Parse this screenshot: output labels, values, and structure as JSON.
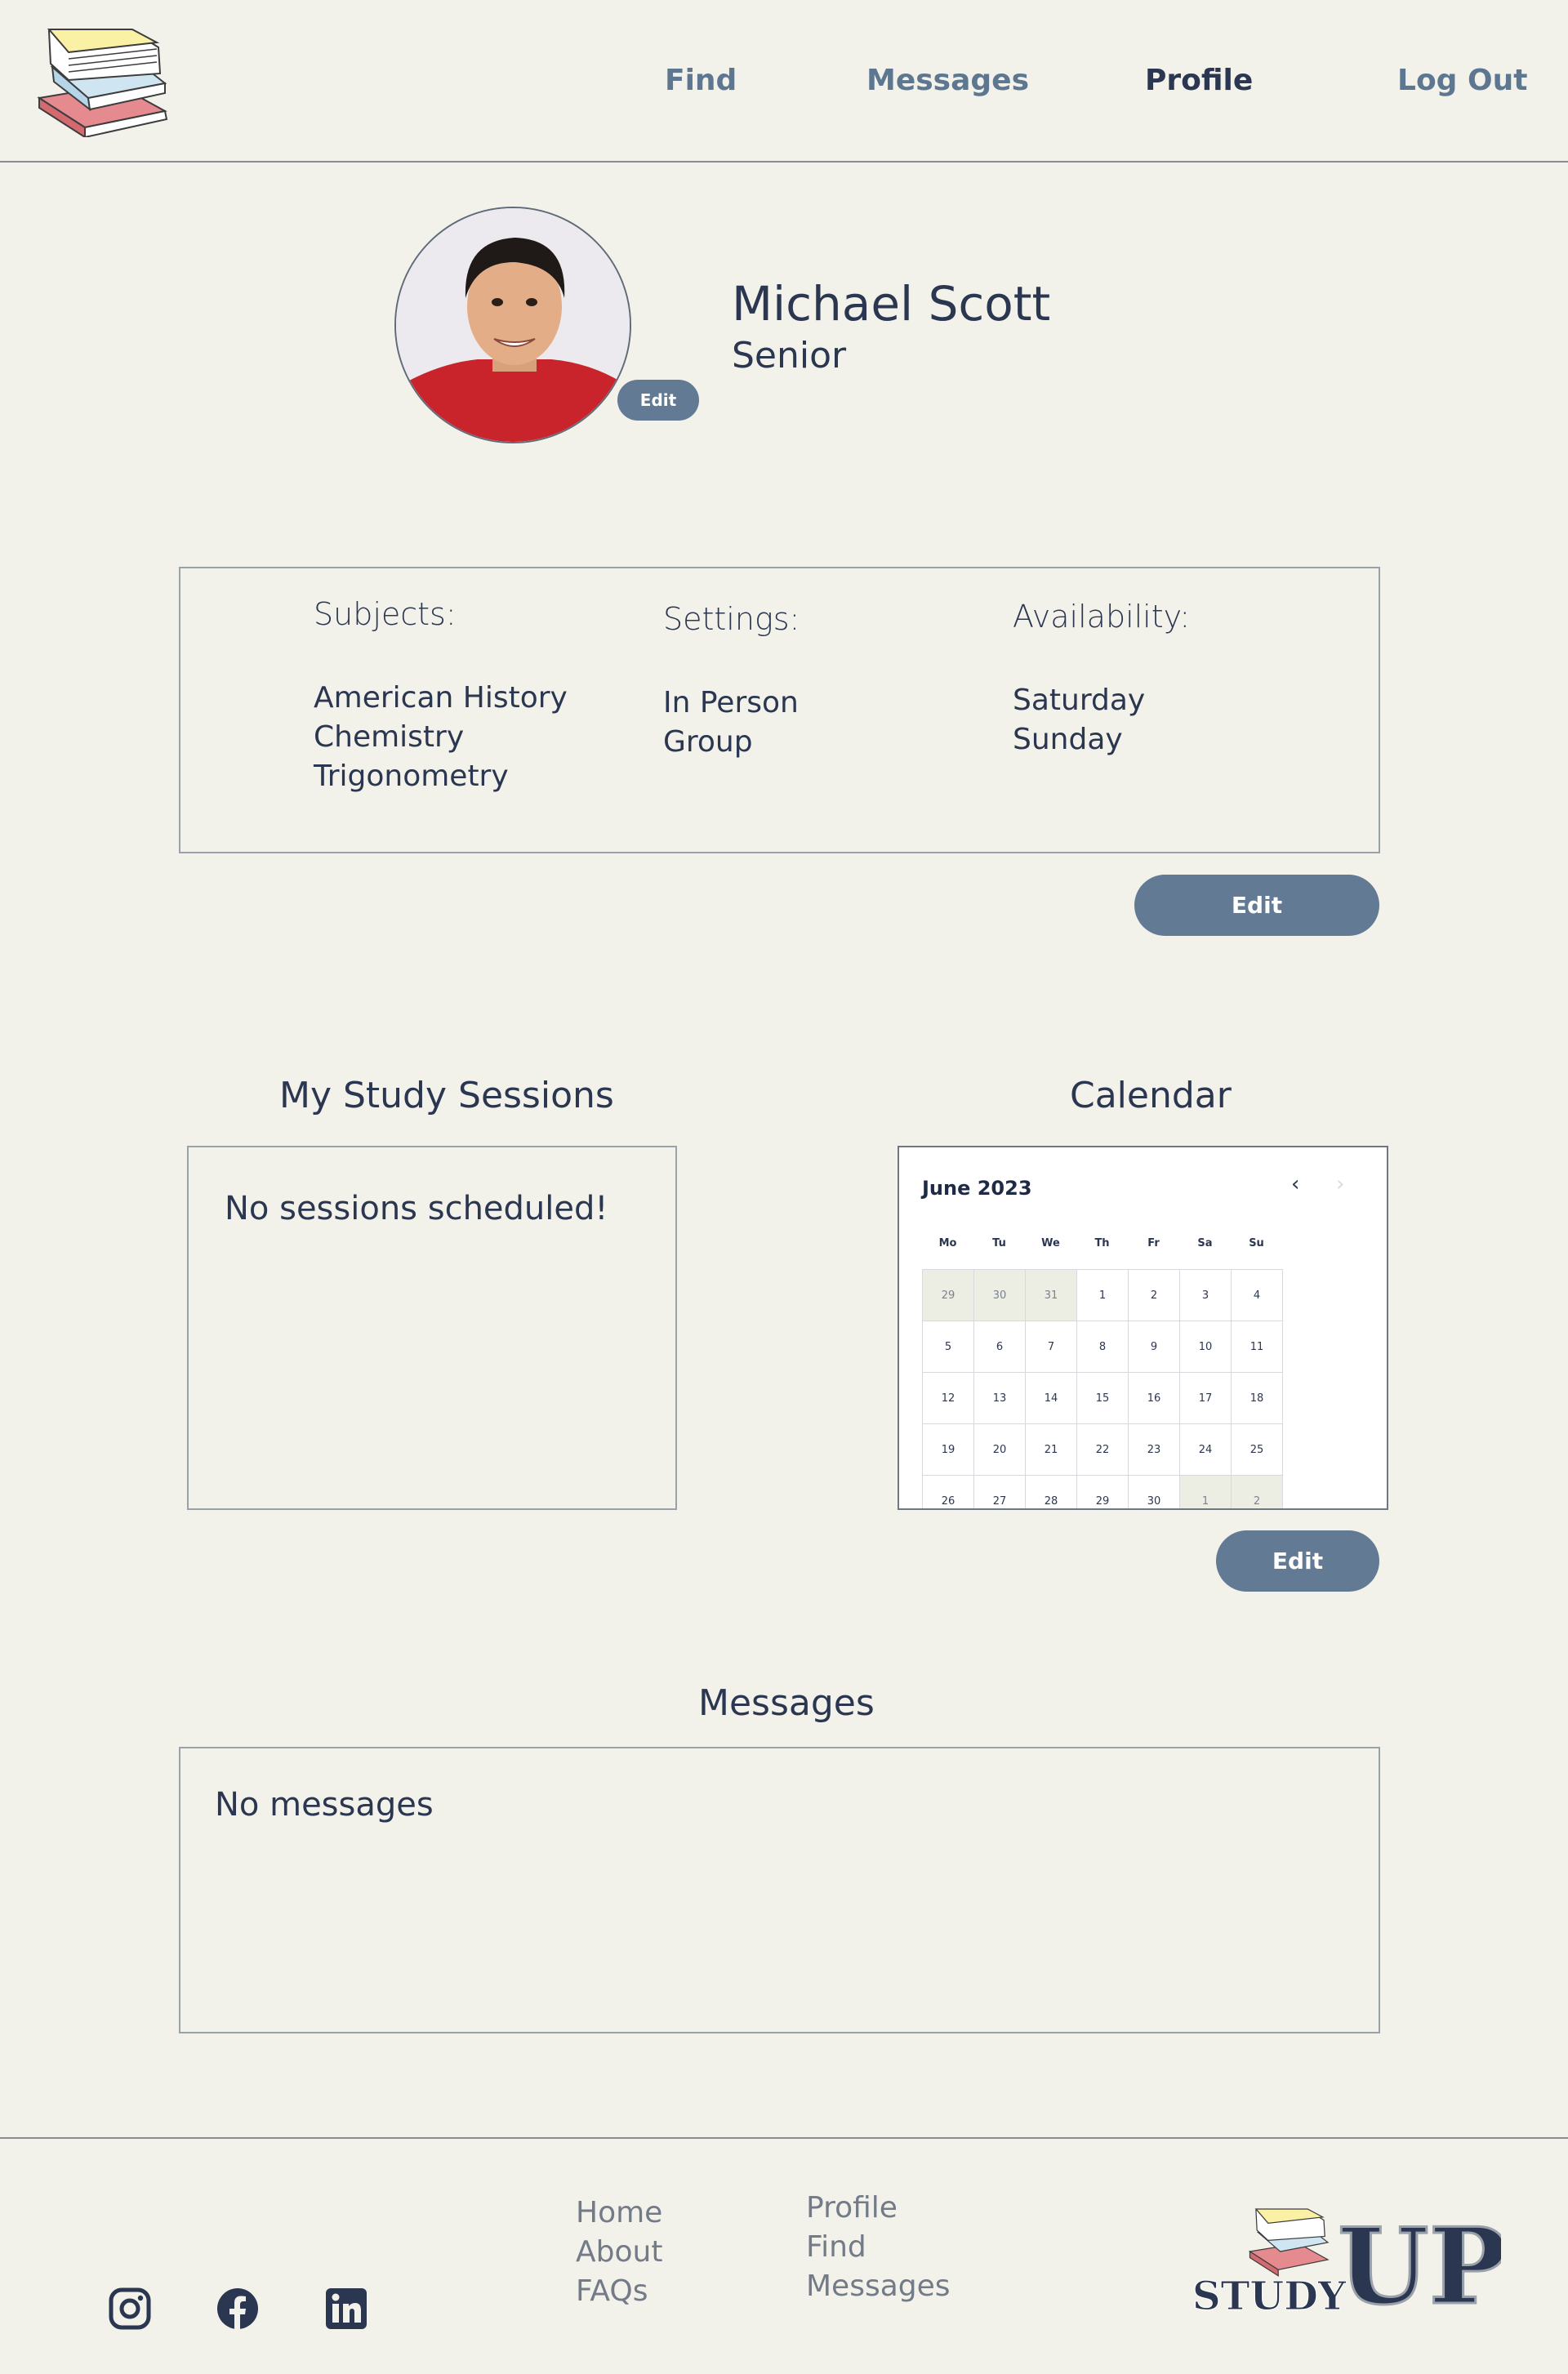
{
  "nav": {
    "find": "Find",
    "messages": "Messages",
    "profile": "Profile",
    "logout": "Log Out",
    "active": "profile"
  },
  "profile": {
    "name": "Michael Scott",
    "year": "Senior",
    "photo_edit_label": "Edit"
  },
  "info": {
    "subjects_label": "Subjects:",
    "subjects": [
      "American History",
      "Chemistry",
      "Trigonometry"
    ],
    "settings_label": "Settings:",
    "settings": [
      "In Person",
      "Group"
    ],
    "availability_label": "Availability:",
    "availability": [
      "Saturday",
      "Sunday"
    ],
    "edit_label": "Edit"
  },
  "sessions": {
    "title": "My Study Sessions",
    "empty_text": "No sessions scheduled!"
  },
  "calendar": {
    "title": "Calendar",
    "month_label": "June 2023",
    "prev_icon": "‹",
    "next_icon": "›",
    "weekdays": [
      "Mo",
      "Tu",
      "We",
      "Th",
      "Fr",
      "Sa",
      "Su"
    ],
    "days": [
      [
        "29",
        "30",
        "31",
        "1",
        "2",
        "3",
        "4"
      ],
      [
        "5",
        "6",
        "7",
        "8",
        "9",
        "10",
        "11"
      ],
      [
        "12",
        "13",
        "14",
        "15",
        "16",
        "17",
        "18"
      ],
      [
        "19",
        "20",
        "21",
        "22",
        "23",
        "24",
        "25"
      ],
      [
        "26",
        "27",
        "28",
        "29",
        "30",
        "1",
        "2"
      ]
    ],
    "edit_label": "Edit"
  },
  "messages": {
    "title": "Messages",
    "empty_text": "No messages"
  },
  "footer": {
    "col1": [
      "Home",
      "About",
      "FAQs"
    ],
    "col2": [
      "Profile",
      "Find",
      "Messages"
    ],
    "social_icons": [
      "instagram-icon",
      "facebook-icon",
      "linkedin-icon"
    ],
    "brand_small": "STUDY",
    "brand_big": "UP"
  },
  "colors": {
    "background": "#f3f2ea",
    "accent_button": "#627a93",
    "nav_text": "#5e7791",
    "dark_text": "#2b3650"
  }
}
